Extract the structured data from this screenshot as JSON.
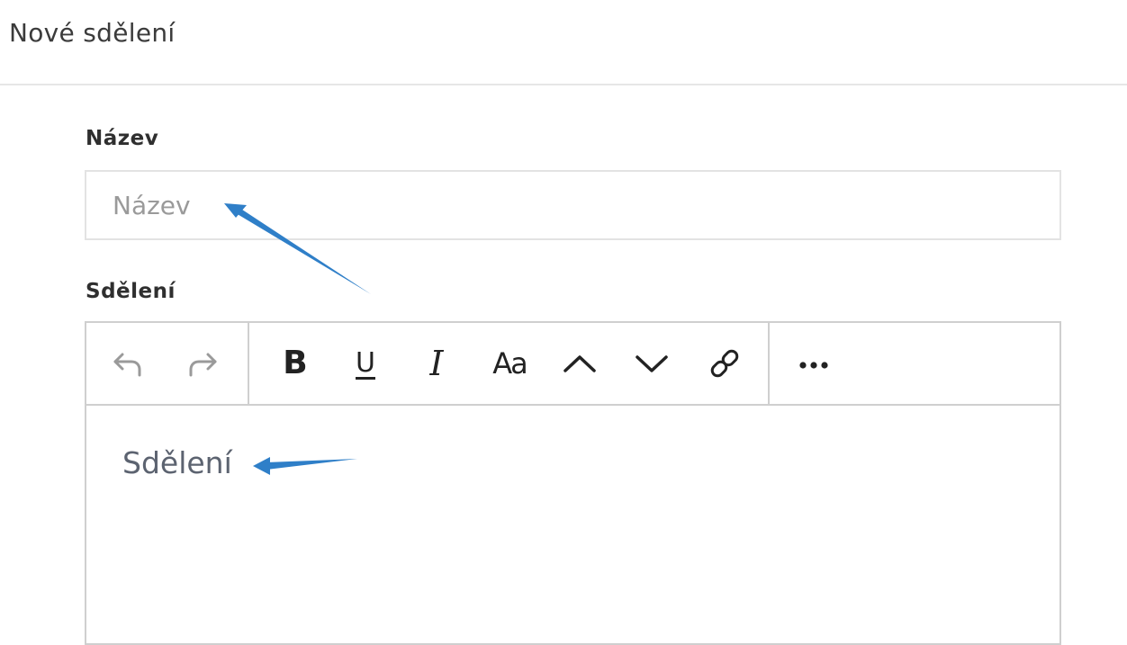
{
  "header": {
    "title": "Nové sdělení"
  },
  "form": {
    "title_label": "Název",
    "title_placeholder": "Název",
    "message_label": "Sdělení",
    "message_placeholder": "Sdělení"
  },
  "toolbar": {
    "groups": [
      [
        "undo-icon",
        "redo-icon"
      ],
      [
        "bold-icon",
        "underline-icon",
        "italic-icon",
        "font-size-icon",
        "chevron-up-icon",
        "chevron-down-icon",
        "link-icon"
      ],
      [
        "more-icon"
      ]
    ],
    "bold_glyph": "B",
    "underline_glyph": "U",
    "italic_glyph": "I",
    "font_size_glyph": "Aa"
  },
  "colors": {
    "annotation_arrow": "#2f7fc8",
    "icon_muted": "#9a9a9a",
    "icon_active": "#222222",
    "border": "#cfcfcf"
  }
}
